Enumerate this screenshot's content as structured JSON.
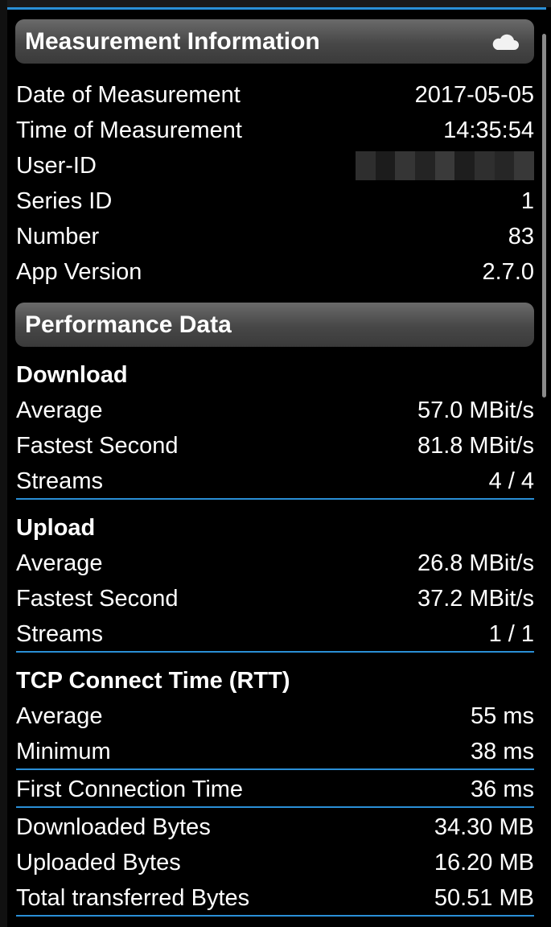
{
  "measurement": {
    "title": "Measurement Information",
    "header_icon": "cloud-icon",
    "rows": [
      {
        "label": "Date of Measurement",
        "value": "2017-05-05"
      },
      {
        "label": "Time of Measurement",
        "value": "14:35:54"
      },
      {
        "label": "User-ID",
        "value": ""
      },
      {
        "label": "Series ID",
        "value": "1"
      },
      {
        "label": "Number",
        "value": "83"
      },
      {
        "label": "App Version",
        "value": "2.7.0"
      }
    ]
  },
  "performance": {
    "title": "Performance Data",
    "download": {
      "title": "Download",
      "rows": [
        {
          "label": "Average",
          "value": "57.0 MBit/s"
        },
        {
          "label": "Fastest Second",
          "value": "81.8 MBit/s"
        },
        {
          "label": "Streams",
          "value": "4 / 4"
        }
      ]
    },
    "upload": {
      "title": "Upload",
      "rows": [
        {
          "label": "Average",
          "value": "26.8 MBit/s"
        },
        {
          "label": "Fastest Second",
          "value": "37.2 MBit/s"
        },
        {
          "label": "Streams",
          "value": "1 / 1"
        }
      ]
    },
    "tcp": {
      "title": "TCP Connect Time (RTT)",
      "rows": [
        {
          "label": "Average",
          "value": "55 ms"
        },
        {
          "label": "Minimum",
          "value": "38 ms"
        }
      ]
    },
    "first_connection": {
      "label": "First Connection Time",
      "value": "36 ms"
    },
    "bytes": [
      {
        "label": "Downloaded Bytes",
        "value": "34.30 MB"
      },
      {
        "label": "Uploaded Bytes",
        "value": "16.20 MB"
      },
      {
        "label": "Total transferred Bytes",
        "value": "50.51 MB"
      }
    ]
  },
  "colors": {
    "accent": "#2a8fd6",
    "header": "#555555",
    "background": "#000000"
  }
}
